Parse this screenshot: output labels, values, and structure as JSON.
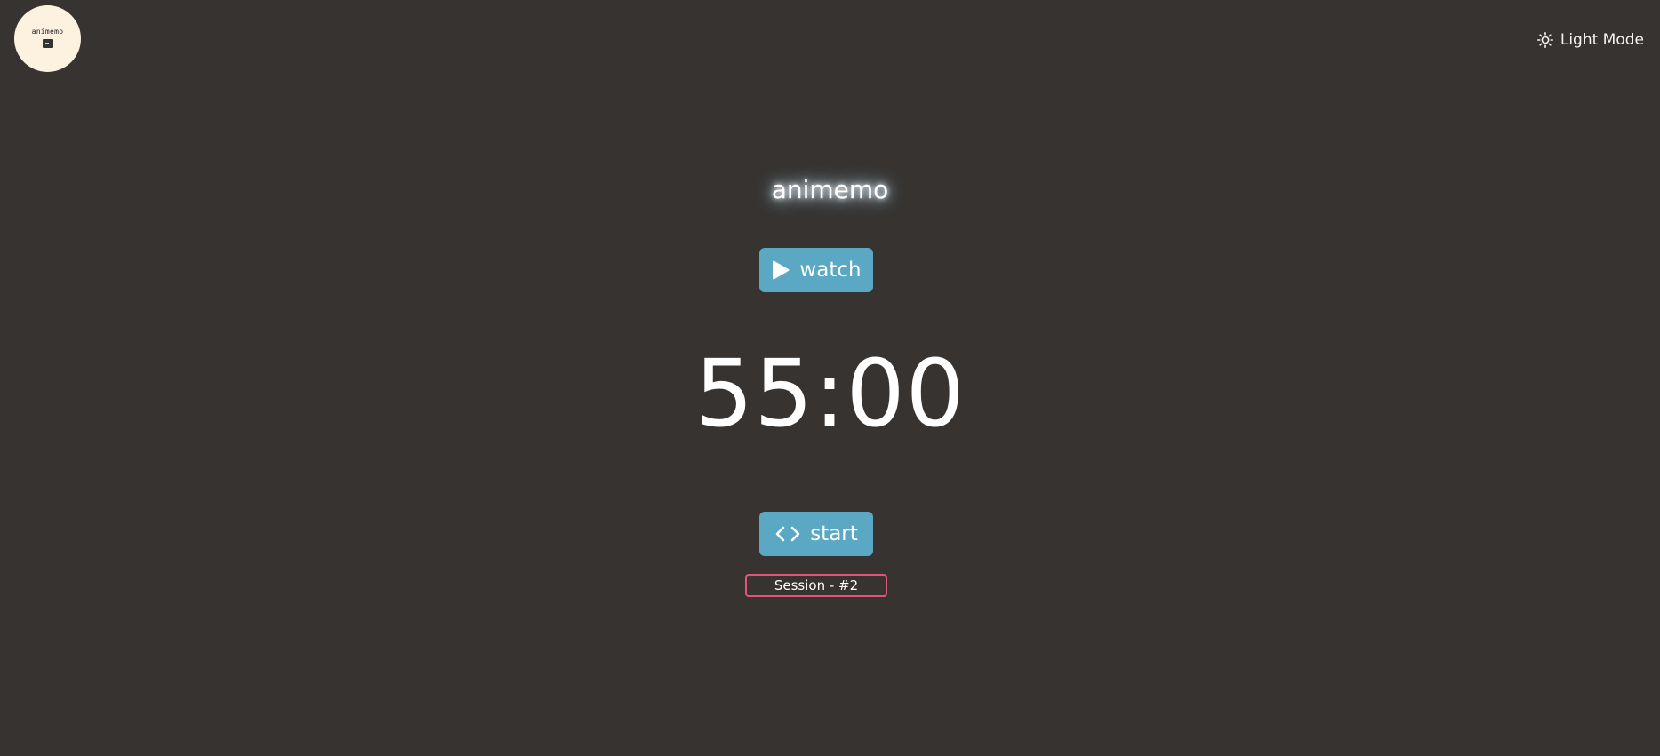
{
  "header": {
    "logo_text": "animemo",
    "logo_icon": "terminal-icon",
    "theme_toggle_label": "Light Mode",
    "theme_toggle_icon": "sun-icon"
  },
  "main": {
    "title": "animemo",
    "watch_label": "watch",
    "watch_icon": "play-icon",
    "timer": "55:00",
    "start_label": "start",
    "start_icon": "code-icon",
    "session_label": "Session - #2"
  },
  "colors": {
    "background": "#363331",
    "button": "#5aa8c3",
    "session_border": "#e2557a",
    "logo_bg": "#fdf1e0"
  }
}
